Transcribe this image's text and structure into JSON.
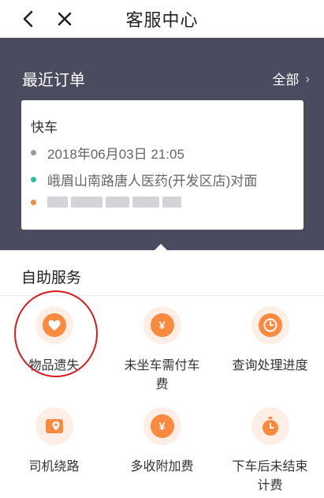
{
  "header": {
    "title": "客服中心",
    "back_icon": "chevron-left-icon",
    "close_icon": "close-icon"
  },
  "recent_orders": {
    "title": "最近订单",
    "all_label": "全部",
    "chevron": "›",
    "card": {
      "type": "快车",
      "time": "2018年06月03日 21:05",
      "from": "峨眉山南路唐人医药(开发区店)对面",
      "to_redacted": true
    }
  },
  "self_service": {
    "title": "自助服务",
    "items": [
      {
        "label": "物品遗失",
        "icon": "heart-icon",
        "highlighted": true
      },
      {
        "label": "未坐车需付车费",
        "icon": "yen-icon"
      },
      {
        "label": "查询处理进度",
        "icon": "clock-icon"
      },
      {
        "label": "司机绕路",
        "icon": "map-marker-icon"
      },
      {
        "label": "多收附加费",
        "icon": "yen-icon"
      },
      {
        "label": "下车后未结束计费",
        "icon": "stopwatch-icon"
      }
    ]
  },
  "colors": {
    "hero_bg": "#4b4b60",
    "accent": "#fa8a40",
    "accent_soft": "#fdeee6",
    "highlight_ring": "#d9191f"
  }
}
